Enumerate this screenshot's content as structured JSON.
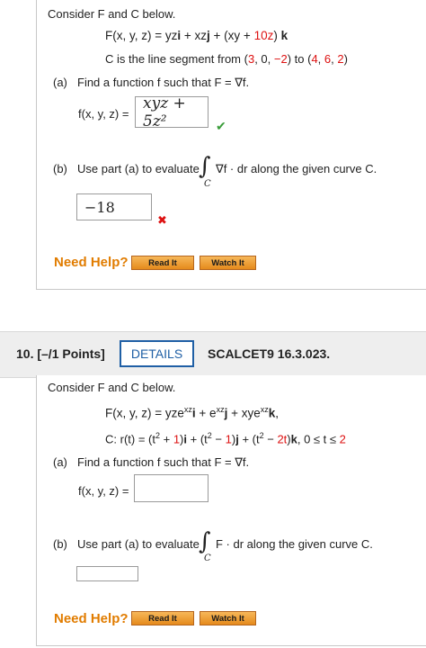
{
  "problem9": {
    "intro": "Consider F and C below.",
    "field_prefix": "F(x, y, z) = yz",
    "field_i": "i",
    "field_mid1": " + xz",
    "field_j": "j",
    "field_mid2": " + (xy + ",
    "field_10z": "10z",
    "field_mid3": ") ",
    "field_k": "k",
    "curve_text1": "C is the line segment from (",
    "p1a": "3",
    "p1b": ", 0, ",
    "p1c": "−2",
    "curve_text2": ") to (",
    "p2a": "4",
    "p2b": ", ",
    "p2c": "6",
    "p2d": ", ",
    "p2e": "2",
    "curve_text3": ")",
    "part_a_label": "(a)",
    "part_a_text": "Find a function f such that F = ∇f.",
    "f_label": "f(x, y, z) =",
    "f_answer": "xyz + 5z²",
    "check_icon": "✔",
    "part_b_label": "(b)",
    "part_b_text1": "Use part (a) to evaluate",
    "integral_symbol": "∫",
    "integral_sub": "C",
    "part_b_text2": "∇f · dr along the given curve C.",
    "b_answer": "−18",
    "cross_icon": "✖",
    "need_help": "Need Help?",
    "read_it": "Read It",
    "watch_it": "Watch It"
  },
  "problem10": {
    "number": "10.",
    "points": "[–/1 Points]",
    "details": "DETAILS",
    "code": "SCALCET9 16.3.023.",
    "intro": "Consider F and C below.",
    "field": "F(x, y, z) = yze^(xz) i + e^(xz) j + xye^(xz) k,",
    "field_a": "F(x, y, z) = yze",
    "field_sup1": "xz",
    "field_i": "i",
    "field_b": " + e",
    "field_sup2": "xz",
    "field_j": "j",
    "field_c": " + xye",
    "field_sup3": "xz",
    "field_k": "k",
    "field_end": ",",
    "curve_a": "C: r(t) = (t",
    "curve_sq1": "2",
    "curve_b": " + ",
    "curve_1a": "1",
    "curve_c": ")",
    "curve_i": "i",
    "curve_d": " + (t",
    "curve_sq2": "2",
    "curve_e": " − ",
    "curve_1b": "1",
    "curve_f": ")",
    "curve_j": "j",
    "curve_g": " + (t",
    "curve_sq3": "2",
    "curve_h": " − ",
    "curve_2t": "2t",
    "curve_i2": ")",
    "curve_k": "k",
    "curve_j2": ",   0 ≤ t ≤ ",
    "curve_2": "2",
    "part_a_label": "(a)",
    "part_a_text": "Find a function f such that F = ∇f.",
    "f_label": "f(x, y, z) =",
    "f_answer": "",
    "part_b_label": "(b)",
    "part_b_text1": "Use part (a) to evaluate",
    "integral_symbol": "∫",
    "integral_sub": "C",
    "part_b_text2": "F · dr along the given curve C.",
    "b_answer": "",
    "need_help": "Need Help?",
    "read_it": "Read It",
    "watch_it": "Watch It"
  },
  "colors": {
    "accent_red": "#d11111",
    "check_green": "#3a9d3a",
    "details_blue": "#1f5fa5",
    "help_orange": "#e17c00"
  }
}
